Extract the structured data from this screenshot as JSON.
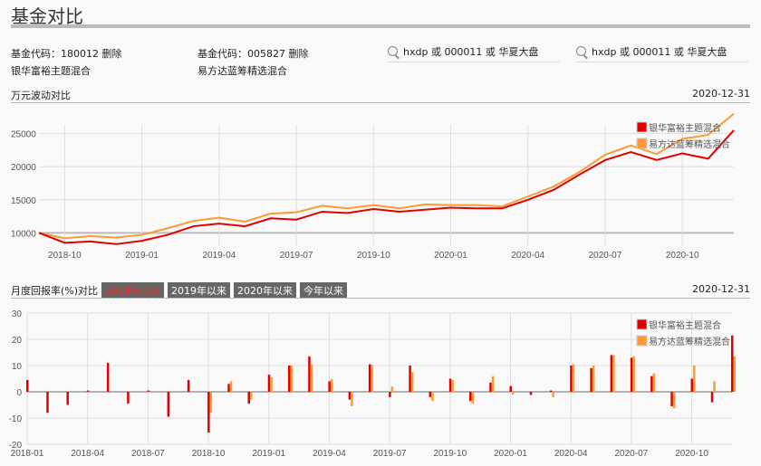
{
  "header": {
    "title": "基金对比"
  },
  "funds": [
    {
      "code_label": "基金代码：",
      "code": "180012",
      "delete_label": "删除",
      "name": "银华富裕主题混合",
      "color": "#e00000"
    },
    {
      "code_label": "基金代码：",
      "code": "005827",
      "delete_label": "删除",
      "name": "易方达蓝筹精选混合",
      "color": "#ff9933"
    }
  ],
  "search": [
    {
      "placeholder": "hxdp 或 000011 或 华夏大盘"
    },
    {
      "placeholder": "hxdp 或 000011 或 华夏大盘"
    }
  ],
  "line_section": {
    "title": "万元波动对比",
    "date": "2020-12-31"
  },
  "bar_section": {
    "title": "月度回报率(%)对比",
    "date": "2020-12-31",
    "ranges": [
      "2018年以来",
      "2019年以来",
      "2020年以来",
      "今年以来"
    ],
    "active_range": 0
  },
  "chart_data": [
    {
      "type": "line",
      "x": [
        "2018-09",
        "2018-10",
        "2018-11",
        "2018-12",
        "2019-01",
        "2019-02",
        "2019-03",
        "2019-04",
        "2019-05",
        "2019-06",
        "2019-07",
        "2019-08",
        "2019-09",
        "2019-10",
        "2019-11",
        "2019-12",
        "2020-01",
        "2020-02",
        "2020-03",
        "2020-04",
        "2020-05",
        "2020-06",
        "2020-07",
        "2020-08",
        "2020-09",
        "2020-10",
        "2020-11",
        "2020-12"
      ],
      "xticks": [
        "2018-10",
        "2019-01",
        "2019-04",
        "2019-07",
        "2019-10",
        "2020-01",
        "2020-04",
        "2020-07",
        "2020-10"
      ],
      "yticks": [
        10000,
        15000,
        20000,
        25000
      ],
      "ylim": [
        8000,
        28500
      ],
      "grid": true,
      "legend": "top-right",
      "series": [
        {
          "name": "银华富裕主题混合",
          "color": "#e00000",
          "values": [
            10000,
            8500,
            8700,
            8300,
            8800,
            9700,
            11000,
            11400,
            11000,
            12200,
            12000,
            13200,
            13000,
            13600,
            13200,
            13500,
            13800,
            13700,
            13700,
            15000,
            16500,
            18800,
            21000,
            22200,
            21000,
            22000,
            21200,
            25500
          ]
        },
        {
          "name": "易方达蓝筹精选混合",
          "color": "#ff9933",
          "values": [
            10000,
            9200,
            9500,
            9300,
            9700,
            10700,
            11800,
            12300,
            11700,
            12900,
            13100,
            14100,
            13700,
            14200,
            13700,
            14300,
            14200,
            14200,
            14000,
            15500,
            17000,
            19200,
            21800,
            23200,
            21900,
            24200,
            24800,
            28000
          ]
        }
      ]
    },
    {
      "type": "bar",
      "x": [
        "2018-01",
        "2018-02",
        "2018-03",
        "2018-04",
        "2018-05",
        "2018-06",
        "2018-07",
        "2018-08",
        "2018-09",
        "2018-10",
        "2018-11",
        "2018-12",
        "2019-01",
        "2019-02",
        "2019-03",
        "2019-04",
        "2019-05",
        "2019-06",
        "2019-07",
        "2019-08",
        "2019-09",
        "2019-10",
        "2019-11",
        "2019-12",
        "2020-01",
        "2020-02",
        "2020-03",
        "2020-04",
        "2020-05",
        "2020-06",
        "2020-07",
        "2020-08",
        "2020-09",
        "2020-10",
        "2020-11",
        "2020-12"
      ],
      "xticks": [
        "2018-01",
        "2018-04",
        "2018-07",
        "2018-10",
        "2019-01",
        "2019-04",
        "2019-07",
        "2019-10",
        "2020-01",
        "2020-04",
        "2020-07",
        "2020-10"
      ],
      "yticks": [
        -20,
        -10,
        0,
        10,
        20,
        30
      ],
      "ylim": [
        -20,
        30
      ],
      "grid": true,
      "legend": "top-right",
      "series": [
        {
          "name": "银华富裕主题混合",
          "color": "#e00000",
          "values": [
            4.5,
            -8,
            -5,
            0.5,
            11,
            -4.5,
            0.5,
            -9.5,
            4.5,
            -15.5,
            3,
            -4.5,
            6.5,
            10,
            13.5,
            4,
            -3,
            10.5,
            -2,
            10,
            -2,
            5,
            -3.5,
            3.5,
            2.2,
            -1.2,
            0.5,
            10,
            9,
            14,
            13,
            6,
            -5.5,
            5,
            -4,
            21.5
          ]
        },
        {
          "name": "易方达蓝筹精选混合",
          "color": "#ff9933",
          "values": [
            null,
            null,
            null,
            null,
            null,
            null,
            null,
            null,
            null,
            -8,
            4,
            -3,
            5.5,
            10,
            10.5,
            4.8,
            -5.5,
            10.3,
            2,
            7.5,
            -3.5,
            4.5,
            -4.5,
            6,
            -1,
            0,
            -2,
            10.5,
            10,
            14,
            13.5,
            7,
            -6.3,
            10,
            4,
            13.5
          ]
        }
      ]
    }
  ]
}
